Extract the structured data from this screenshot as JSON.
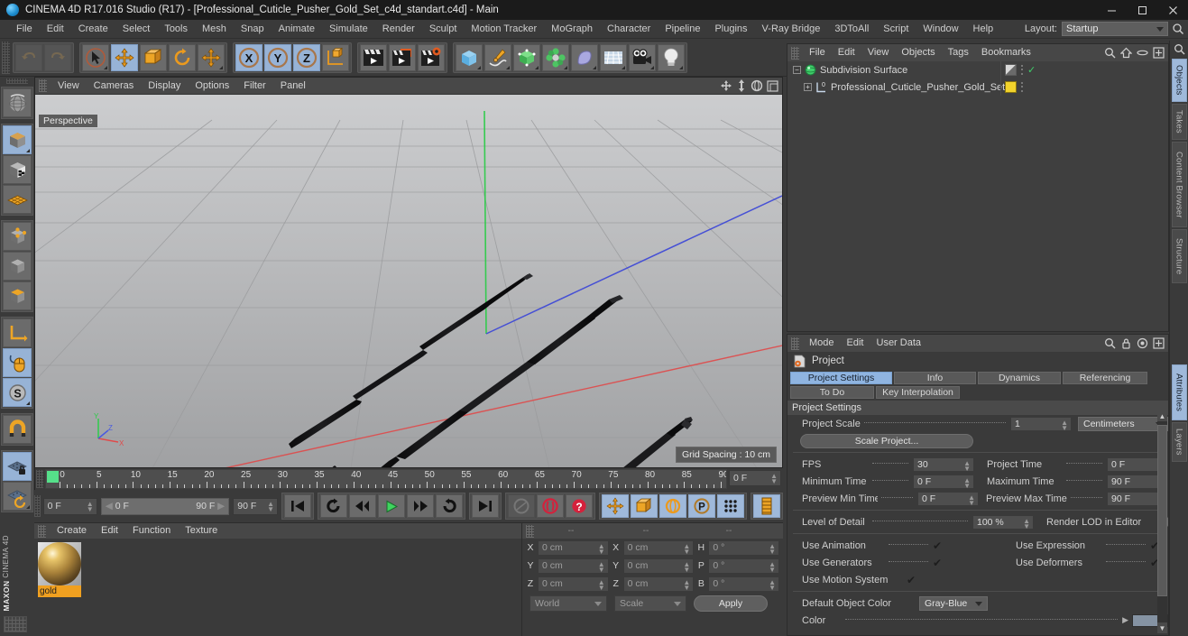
{
  "window": {
    "title": "CINEMA 4D R17.016 Studio (R17) - [Professional_Cuticle_Pusher_Gold_Set_c4d_standart.c4d] - Main",
    "app_icon": "cinema4d-logo-icon",
    "minimize_label": "─",
    "maximize_label": "❐",
    "close_label": "✕"
  },
  "menubar": {
    "items": [
      {
        "label": "File"
      },
      {
        "label": "Edit"
      },
      {
        "label": "Create"
      },
      {
        "label": "Select"
      },
      {
        "label": "Tools"
      },
      {
        "label": "Mesh"
      },
      {
        "label": "Snap"
      },
      {
        "label": "Animate"
      },
      {
        "label": "Simulate"
      },
      {
        "label": "Render"
      },
      {
        "label": "Sculpt"
      },
      {
        "label": "Motion Tracker"
      },
      {
        "label": "MoGraph"
      },
      {
        "label": "Character"
      },
      {
        "label": "Pipeline"
      },
      {
        "label": "Plugins"
      },
      {
        "label": "V-Ray Bridge"
      },
      {
        "label": "3DToAll"
      },
      {
        "label": "Script"
      },
      {
        "label": "Window"
      },
      {
        "label": "Help"
      }
    ],
    "layout_label": "Layout:",
    "layout_value": "Startup"
  },
  "top_toolbar": {
    "groups": [
      {
        "buttons": [
          {
            "name": "undo-button",
            "icon": "undo-icon",
            "state": "disabled"
          },
          {
            "name": "redo-button",
            "icon": "redo-icon",
            "state": "disabled"
          }
        ]
      },
      {
        "buttons": [
          {
            "name": "live-selection-button",
            "icon": "cursor-select-icon",
            "state": "normal"
          },
          {
            "name": "move-tool-button",
            "icon": "move-arrows-icon",
            "state": "selected"
          },
          {
            "name": "scale-tool-button",
            "icon": "scale-box-icon",
            "state": "normal"
          },
          {
            "name": "rotate-tool-button",
            "icon": "rotate-circle-icon",
            "state": "normal"
          },
          {
            "name": "move-alt-button",
            "icon": "move-arrows-icon",
            "state": "normal"
          }
        ]
      },
      {
        "buttons": [
          {
            "name": "lock-x-axis-button",
            "icon": "axis-x-icon",
            "state": "selected"
          },
          {
            "name": "lock-y-axis-button",
            "icon": "axis-y-icon",
            "state": "selected"
          },
          {
            "name": "lock-z-axis-button",
            "icon": "axis-z-icon",
            "state": "selected"
          },
          {
            "name": "world-object-coord-button",
            "icon": "world-axis-cube-icon",
            "state": "normal"
          }
        ]
      },
      {
        "buttons": [
          {
            "name": "render-view-button",
            "icon": "render-clapper-icon",
            "state": "normal"
          },
          {
            "name": "render-region-button",
            "icon": "render-region-icon",
            "state": "normal"
          },
          {
            "name": "render-settings-button",
            "icon": "render-settings-gear-icon",
            "state": "normal"
          }
        ]
      },
      {
        "buttons": [
          {
            "name": "add-cube-button",
            "icon": "cube-blue-icon",
            "state": "normal"
          },
          {
            "name": "add-spline-button",
            "icon": "pen-spline-icon",
            "state": "normal"
          },
          {
            "name": "add-generator-button",
            "icon": "green-cube-generator-icon",
            "state": "normal"
          },
          {
            "name": "add-mograph-button",
            "icon": "cloner-green-icon",
            "state": "normal"
          },
          {
            "name": "add-deformer-button",
            "icon": "bend-deformer-icon",
            "state": "normal"
          },
          {
            "name": "add-scene-button",
            "icon": "floor-grid-icon",
            "state": "normal"
          },
          {
            "name": "add-camera-button",
            "icon": "camera-icon",
            "state": "normal"
          },
          {
            "name": "add-light-button",
            "icon": "lightbulb-icon",
            "state": "normal"
          }
        ]
      }
    ]
  },
  "left_toolbar": {
    "groups": [
      {
        "buttons": [
          {
            "name": "undo-view-button",
            "icon": "globe-wire-icon",
            "state": "normal"
          }
        ]
      },
      {
        "buttons": [
          {
            "name": "editable-object-button",
            "icon": "make-editable-cube-icon",
            "state": "selected"
          },
          {
            "name": "texture-axis-button",
            "icon": "checker-cube-icon",
            "state": "normal"
          },
          {
            "name": "enable-axis-button",
            "icon": "orange-grid-plane-icon",
            "state": "normal"
          }
        ]
      },
      {
        "buttons": [
          {
            "name": "point-mode-button",
            "icon": "point-cube-icon",
            "state": "normal"
          },
          {
            "name": "edge-mode-button",
            "icon": "edge-cube-icon",
            "state": "normal"
          },
          {
            "name": "polygon-mode-button",
            "icon": "polygon-cube-icon",
            "state": "normal"
          }
        ]
      },
      {
        "buttons": [
          {
            "name": "model-axis-button",
            "icon": "axis-corner-icon",
            "state": "normal"
          },
          {
            "name": "viewport-solo-button",
            "icon": "mouse-icon",
            "state": "selected"
          },
          {
            "name": "snap-s-button",
            "icon": "s-circle-icon",
            "state": "selected"
          }
        ]
      },
      {
        "buttons": [
          {
            "name": "magnet-button",
            "icon": "magnet-icon",
            "state": "normal"
          }
        ]
      },
      {
        "buttons": [
          {
            "name": "workplane-lock-button",
            "icon": "grid-lock-icon",
            "state": "selected"
          },
          {
            "name": "workplane-rotate-button",
            "icon": "grid-rotate-icon",
            "state": "normal"
          }
        ]
      }
    ],
    "brand_line1": "MAXON",
    "brand_line2": "CINEMA 4D"
  },
  "viewport": {
    "menu": [
      {
        "label": "View"
      },
      {
        "label": "Cameras"
      },
      {
        "label": "Display"
      },
      {
        "label": "Options"
      },
      {
        "label": "Filter"
      },
      {
        "label": "Panel"
      }
    ],
    "icons": [
      {
        "name": "viewport-pan-icon"
      },
      {
        "name": "viewport-dolly-icon"
      },
      {
        "name": "viewport-rotate-icon"
      },
      {
        "name": "viewport-maximize-icon"
      }
    ],
    "label": "Perspective",
    "grid_spacing": "Grid Spacing : 10 cm",
    "axis_labels": {
      "y": "Y",
      "x": "X",
      "z": "Z"
    }
  },
  "timeline": {
    "ticks": [
      0,
      5,
      10,
      15,
      20,
      25,
      30,
      35,
      40,
      45,
      50,
      55,
      60,
      65,
      70,
      75,
      80,
      85,
      90
    ],
    "min": 0,
    "max": 90,
    "playhead_frame": 0,
    "current_frame_field": "0 F"
  },
  "transport": {
    "current_time": "0 F",
    "range_start": "0 F",
    "range_end": "90 F",
    "max_time": "90 F",
    "buttons": [
      {
        "name": "go-to-start-button",
        "icon": "skip-start-icon"
      },
      {
        "name": "play-backwards-loop-button",
        "icon": "loop-reverse-icon"
      },
      {
        "name": "step-back-button",
        "icon": "step-back-icon"
      },
      {
        "name": "play-button",
        "icon": "play-triangle-icon"
      },
      {
        "name": "step-forward-button",
        "icon": "step-forward-icon"
      },
      {
        "name": "loop-button",
        "icon": "loop-icon"
      },
      {
        "name": "go-to-end-button",
        "icon": "skip-end-icon"
      },
      {
        "name": "record-active-objects-button",
        "icon": "record-gray-icon"
      },
      {
        "name": "autokeying-button",
        "icon": "keying-red-icon"
      },
      {
        "name": "keyframe-selection-button",
        "icon": "question-red-icon"
      },
      {
        "name": "record-position-button",
        "icon": "position-cross-icon"
      },
      {
        "name": "record-scale-button",
        "icon": "scale-orange-icon"
      },
      {
        "name": "record-rotation-button",
        "icon": "rotation-orange-icon"
      },
      {
        "name": "record-parameter-button",
        "icon": "parameter-p-icon"
      },
      {
        "name": "record-pla-button",
        "icon": "pla-dots-icon"
      },
      {
        "name": "timeline-panel-button",
        "icon": "timeline-strip-icon"
      }
    ]
  },
  "material_manager": {
    "menu": [
      {
        "label": "Create"
      },
      {
        "label": "Edit"
      },
      {
        "label": "Function"
      },
      {
        "label": "Texture"
      }
    ],
    "materials": [
      {
        "name": "gold",
        "preview": "gold-sphere-icon"
      }
    ]
  },
  "coordinates": {
    "header_dashes": [
      "--",
      "--",
      "--"
    ],
    "rows": [
      {
        "lab1": "X",
        "val1": "0 cm",
        "lab2": "X",
        "val2": "0 cm",
        "lab3": "H",
        "val3": "0 °"
      },
      {
        "lab1": "Y",
        "val1": "0 cm",
        "lab2": "Y",
        "val2": "0 cm",
        "lab3": "P",
        "val3": "0 °"
      },
      {
        "lab1": "Z",
        "val1": "0 cm",
        "lab2": "Z",
        "val2": "0 cm",
        "lab3": "B",
        "val3": "0 °"
      }
    ],
    "system": "World",
    "mode": "Scale",
    "apply_label": "Apply"
  },
  "object_manager": {
    "menu": [
      {
        "label": "File"
      },
      {
        "label": "Edit"
      },
      {
        "label": "View"
      },
      {
        "label": "Objects"
      },
      {
        "label": "Tags"
      },
      {
        "label": "Bookmarks"
      }
    ],
    "icons": [
      {
        "name": "search-icon"
      },
      {
        "name": "home-up-icon"
      },
      {
        "name": "eye-visibility-icon"
      },
      {
        "name": "expand-panel-icon"
      }
    ],
    "rows": [
      {
        "name": "Subdivision Surface",
        "icon": "subdivision-surface-green-icon",
        "indent": 0,
        "tag_swatch": "#8a8a8a",
        "tag_check": "✓"
      },
      {
        "name": "Professional_Cuticle_Pusher_Gold_Set",
        "icon": "null-object-icon",
        "indent": 1,
        "tag_swatch": "#f2d32c",
        "tag_check": ""
      }
    ]
  },
  "attribute_manager": {
    "menu": [
      {
        "label": "Mode"
      },
      {
        "label": "Edit"
      },
      {
        "label": "User Data"
      }
    ],
    "icons": [
      {
        "name": "search-icon"
      },
      {
        "name": "lock-icon"
      },
      {
        "name": "target-icon"
      },
      {
        "name": "expand-panel-icon"
      }
    ],
    "object_title": "Project",
    "object_icon": "project-settings-icon",
    "tabs_row1": [
      {
        "label": "Project Settings",
        "active": true
      },
      {
        "label": "Info",
        "active": false
      },
      {
        "label": "Dynamics",
        "active": false
      },
      {
        "label": "Referencing",
        "active": false
      }
    ],
    "tabs_row2": [
      {
        "label": "To Do",
        "active": false
      },
      {
        "label": "Key Interpolation",
        "active": false
      }
    ],
    "section_title": "Project Settings",
    "project_scale_label": "Project Scale",
    "project_scale_value": "1",
    "project_scale_unit": "Centimeters",
    "scale_project_button": "Scale Project...",
    "fields": [
      {
        "label": "FPS",
        "value": "30",
        "label2": "Project Time",
        "value2": "0 F"
      },
      {
        "label": "Minimum Time",
        "value": "0 F",
        "label2": "Maximum Time",
        "value2": "90 F"
      },
      {
        "label": "Preview Min Time",
        "value": "0 F",
        "label2": "Preview Max Time",
        "value2": "90 F"
      }
    ],
    "lod_label": "Level of Detail",
    "lod_value": "100 %",
    "render_lod_label": "Render LOD in Editor",
    "render_lod_checked": false,
    "checkboxes": [
      {
        "label": "Use Animation",
        "checked": true,
        "label2": "Use Expression",
        "checked2": true
      },
      {
        "label": "Use Generators",
        "checked": true,
        "label2": "Use Deformers",
        "checked2": true
      },
      {
        "label": "Use Motion System",
        "checked": true,
        "label2": "",
        "checked2": null
      }
    ],
    "default_object_color_label": "Default Object Color",
    "default_object_color_value": "Gray-Blue",
    "color_label": "Color",
    "color_swatch": "#8593a3",
    "check_glyph": "✔"
  },
  "vertical_tabs": {
    "top": [
      {
        "label": "Objects",
        "active": true
      },
      {
        "label": "Takes",
        "active": false
      },
      {
        "label": "Content Browser",
        "active": false
      },
      {
        "label": "Structure",
        "active": false
      }
    ],
    "bottom": [
      {
        "label": "Attributes",
        "active": true
      },
      {
        "label": "Layers",
        "active": false
      }
    ]
  },
  "colors": {
    "accent_blue": "#9fb9da",
    "accent_orange": "#f0a020",
    "panel_bg": "#3a3a3a",
    "field_bg": "#4e4e4e"
  }
}
